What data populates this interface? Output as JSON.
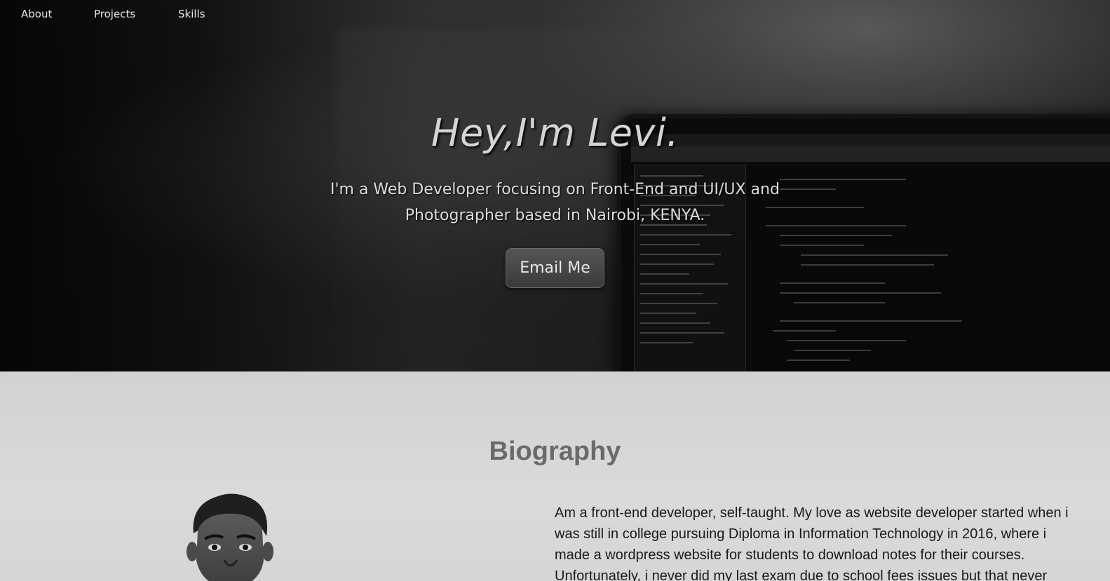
{
  "nav": {
    "items": [
      {
        "label": "About"
      },
      {
        "label": "Projects"
      },
      {
        "label": "Skills"
      }
    ]
  },
  "hero": {
    "title": "Hey,I'm Levi.",
    "subtitle_line1": "I'm a Web Developer focusing on Front-End and UI/UX and",
    "subtitle_line2": "Photographer based in Nairobi, KENYA.",
    "cta_label": "Email Me"
  },
  "bio": {
    "heading": "Biography",
    "text": "Am a front-end developer, self-taught. My love as website developer started when i was still in college pursuing Diploma in Information Technology in 2016, where i made a wordpress website for students to download notes for their courses. Unfortunately, i never did my last exam due to school fees issues but that never"
  }
}
